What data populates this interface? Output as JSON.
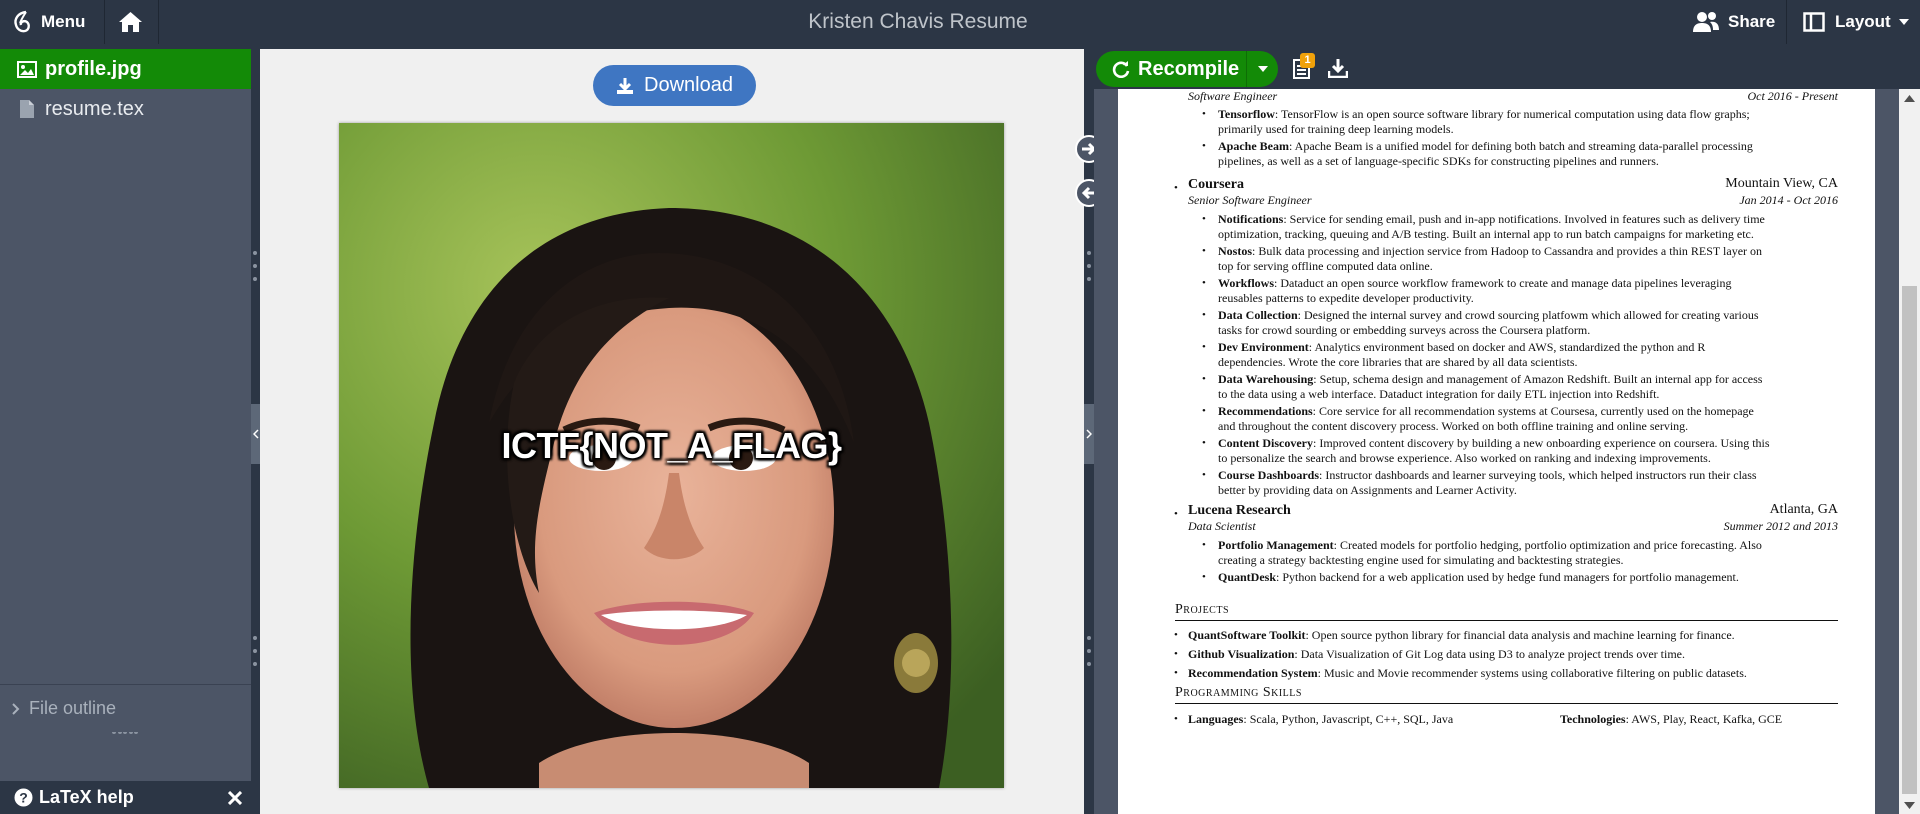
{
  "topbar": {
    "menu_label": "Menu",
    "project_title": "Kristen Chavis Resume",
    "share_label": "Share",
    "layout_label": "Layout"
  },
  "sidebar": {
    "files": [
      {
        "name": "profile.jpg",
        "type": "image",
        "active": true
      },
      {
        "name": "resume.tex",
        "type": "file",
        "active": false
      }
    ],
    "file_outline_label": "File outline",
    "latex_help_label": "LaTeX help"
  },
  "viewer": {
    "download_label": "Download",
    "image_overlay_text": "ICTF{NOT_A_FLAG}"
  },
  "pdf_toolbar": {
    "recompile_label": "Recompile",
    "log_badge": "1"
  },
  "resume": {
    "job0": {
      "title": "Software Engineer",
      "dates": "Oct 2016 - Present"
    },
    "items0": [
      {
        "name": "Tensorflow",
        "text": ": TensorFlow is an open source software library for numerical computation using data flow graphs;",
        "text2": "primarily used for training deep learning models."
      },
      {
        "name": "Apache Beam",
        "text": ": Apache Beam is a unified model for defining both batch and streaming data-parallel processing",
        "text2": "pipelines, as well as a set of language-specific SDKs for constructing pipelines and runners."
      }
    ],
    "job1": {
      "company": "Coursera",
      "location": "Mountain View, CA",
      "title": "Senior Software Engineer",
      "dates": "Jan 2014 - Oct 2016"
    },
    "items1": [
      {
        "name": "Notifications",
        "text": ": Service for sending email, push and in-app notifications. Involved in features such as delivery time",
        "text2": "optimization, tracking, queuing and A/B testing. Built an internal app to run batch campaigns for marketing etc."
      },
      {
        "name": "Nostos",
        "text": ": Bulk data processing and injection service from Hadoop to Cassandra and provides a thin REST layer on",
        "text2": "top for serving offline computed data online."
      },
      {
        "name": "Workflows",
        "text": ": Dataduct an open source workflow framework to create and manage data pipelines leveraging",
        "text2": "reusables patterns to expedite developer productivity."
      },
      {
        "name": "Data Collection",
        "text": ": Designed the internal survey and crowd sourcing platfowm which allowed for creating various",
        "text2": "tasks for crowd sourding or embedding surveys across the Coursera platform."
      },
      {
        "name": "Dev Environment",
        "text": ": Analytics environment based on docker and AWS, standardized the python and R",
        "text2": "dependencies. Wrote the core libraries that are shared by all data scientists."
      },
      {
        "name": "Data Warehousing",
        "text": ": Setup, schema design and management of Amazon Redshift. Built an internal app for access",
        "text2": "to the data using a web interface. Dataduct integration for daily ETL injection into Redshift."
      },
      {
        "name": "Recommendations",
        "text": ": Core service for all recommendation systems at Coursesa, currently used on the homepage",
        "text2": "and throughout the content discovery process. Worked on both offline training and online serving."
      },
      {
        "name": "Content Discovery",
        "text": ": Improved content discovery by building a new onboarding experience on coursera. Using this",
        "text2": "to personalize the search and browse experience. Also worked on ranking and indexing improvements."
      },
      {
        "name": "Course Dashboards",
        "text": ": Instructor dashboards and learner surveying tools, which helped instructors run their class",
        "text2": "better by providing data on Assignments and Learner Activity."
      }
    ],
    "job2": {
      "company": "Lucena Research",
      "location": "Atlanta, GA",
      "title": "Data Scientist",
      "dates": "Summer 2012 and 2013"
    },
    "items2": [
      {
        "name": "Portfolio Management",
        "text": ": Created models for portfolio hedging, portfolio optimization and price forecasting. Also",
        "text2": "creating a strategy backtesting engine used for simulating and backtesting strategies."
      },
      {
        "name": "QuantDesk",
        "text": ": Python backend for a web application used by hedge fund managers for portfolio management.",
        "text2": ""
      }
    ],
    "projects_heading": "Projects",
    "projects": [
      {
        "name": "QuantSoftware Toolkit",
        "text": ": Open source python library for financial data analysis and machine learning for finance."
      },
      {
        "name": "Github Visualization",
        "text": ": Data Visualization of Git Log data using D3 to analyze project trends over time."
      },
      {
        "name": "Recommendation System",
        "text": ": Music and Movie recommender systems using collaborative filtering on public datasets."
      }
    ],
    "skills_heading": "Programming Skills",
    "skills": {
      "languages_label": "Languages",
      "languages": ": Scala, Python, Javascript, C++, SQL, Java",
      "technologies_label": "Technologies",
      "technologies": ": AWS, Play, React, Kafka, GCE"
    }
  },
  "colors": {
    "topbar_bg": "#2c3645",
    "sidebar_bg": "#4c5566",
    "active_file_bg": "#138a07",
    "download_button": "#3f76c2",
    "recompile_button": "#138a07",
    "badge": "#f0a10a"
  }
}
